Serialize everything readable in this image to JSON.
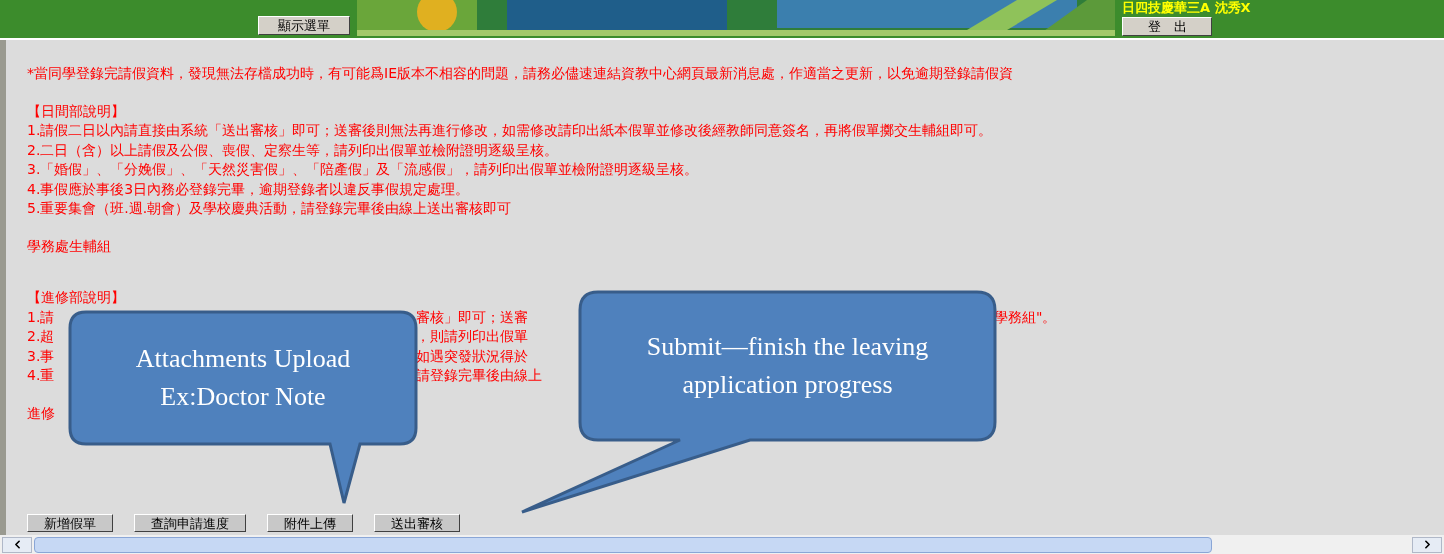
{
  "header": {
    "menu_button": "顯示選單",
    "user": "日四技慶華三A 沈秀X",
    "logout_button": "登　出"
  },
  "notice": "*當同學登錄完請假資料，發現無法存檔成功時，有可能爲IE版本不相容的問題，請務必儘速連結資教中心網頁最新消息處，作適當之更新，以免逾期登錄請假資",
  "sections": [
    {
      "heading": "【日間部說明】",
      "items": [
        {
          "segments": [
            "1.請假二日以內請直接由系統「送出審核」即可；送審後則無法再進行修改，如需修改請印出紙本假單並修改後經教師同意簽名，再將假單擲交生輔組即可。"
          ]
        },
        {
          "segments": [
            "2.二日（含）以上請假及公假、喪假、定察生等，請列印出假單並檢附證明逐級呈核。"
          ]
        },
        {
          "segments": [
            "3.「婚假」、「分娩假」、「天然災害假」、「陪產假」及「流感假」，請列印出假單並檢附證明逐級呈核。"
          ]
        },
        {
          "segments": [
            "4.事假應於事後3日內務必登錄完畢，逾期登錄者以違反事假規定處理。"
          ]
        },
        {
          "segments": [
            "5.重要集會（班.週.朝會）及學校慶典活動，請登錄完畢後由線上送出審核即可"
          ]
        }
      ],
      "footer": "學務處生輔組"
    },
    {
      "heading": "【進修部說明】",
      "items": [
        {
          "segments": [
            "1.請",
            "審核」即可；送審",
            "學務組\"。"
          ]
        },
        {
          "segments": [
            "2.超",
            "，則請列印出假單"
          ]
        },
        {
          "segments": [
            "3.事",
            "如遇突發狀況得於"
          ]
        },
        {
          "segments": [
            "4.重",
            "請登錄完畢後由線上"
          ]
        }
      ],
      "footer": "進修"
    }
  ],
  "buttons": [
    "新增假單",
    "查詢申請進度",
    "附件上傳",
    "送出審核"
  ],
  "callouts": [
    {
      "lines": [
        "Attachments Upload",
        "Ex:Doctor Note"
      ]
    },
    {
      "lines": [
        "Submit—finish the leaving",
        "application progress"
      ]
    }
  ]
}
